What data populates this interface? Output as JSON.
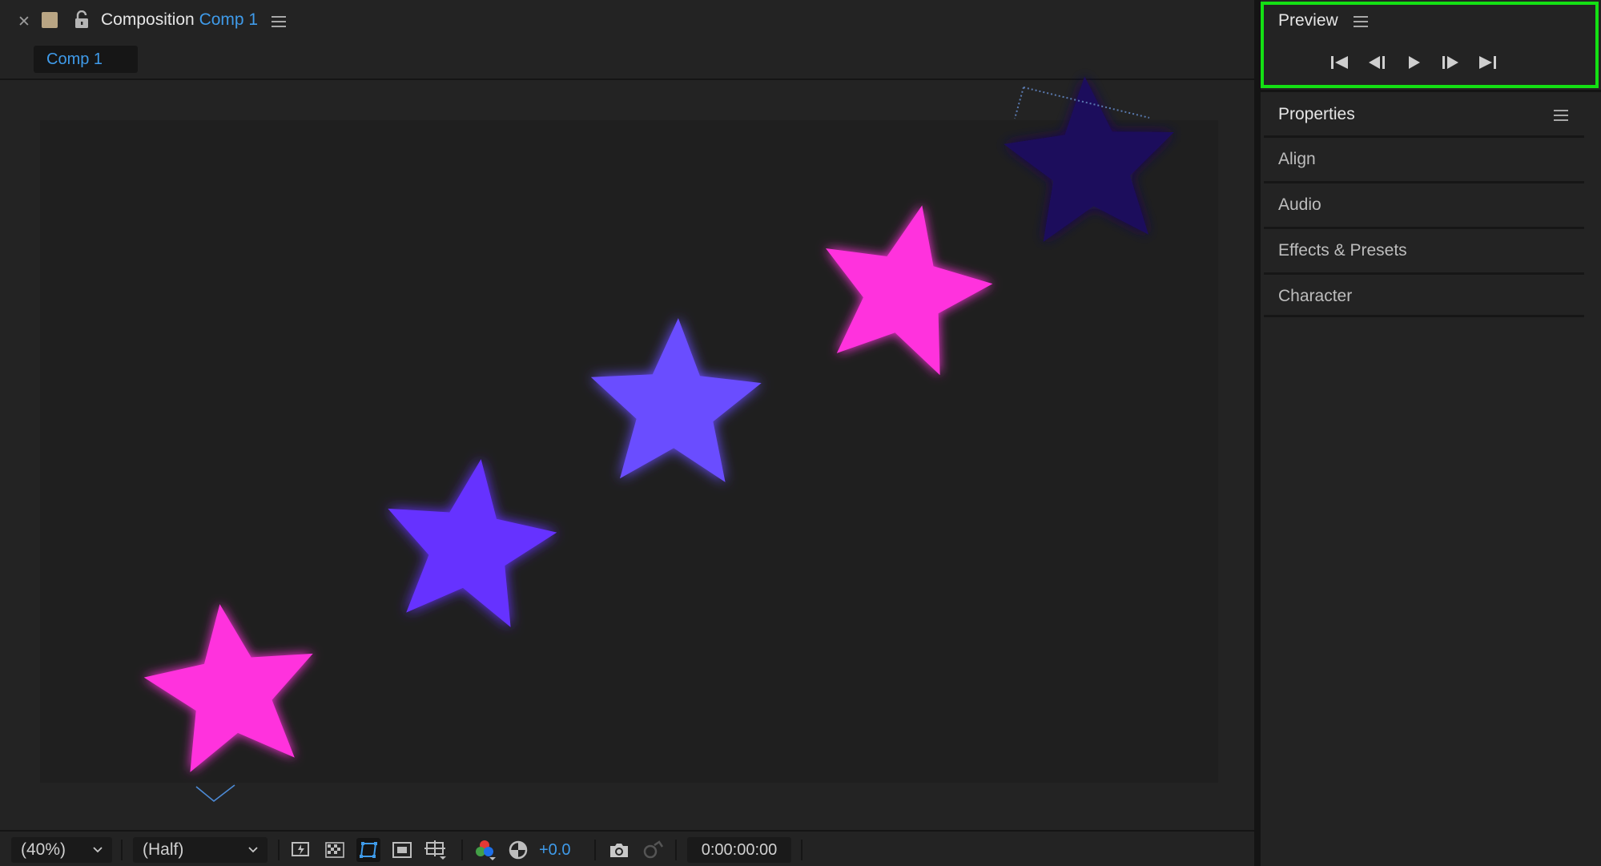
{
  "composition_panel": {
    "title_prefix": "Composition",
    "comp_name": "Comp 1",
    "tab_label": "Comp 1"
  },
  "viewer": {
    "stars": [
      {
        "color": "#ff33dd",
        "glow": "#ff33dd"
      },
      {
        "color": "#6633ff",
        "glow": "#5533ff"
      },
      {
        "color": "#6a4dff",
        "glow": "#4433ff"
      },
      {
        "color": "#ff33dd",
        "glow": "#ff2bd0"
      },
      {
        "color": "#1e0d5c",
        "glow": "#000000"
      }
    ]
  },
  "footer": {
    "magnification": "(40%)",
    "resolution": "(Half)",
    "exposure": "+0.0",
    "timecode": "0:00:00:00"
  },
  "preview_panel": {
    "title": "Preview",
    "controls": [
      "first-frame",
      "previous-frame",
      "play",
      "next-frame",
      "last-frame"
    ]
  },
  "properties_panel": {
    "title": "Properties",
    "items": [
      {
        "label": "Align"
      },
      {
        "label": "Audio"
      },
      {
        "label": "Effects & Presets"
      },
      {
        "label": "Character"
      }
    ]
  },
  "colors": {
    "accent": "#3f9bea",
    "highlight_outline": "#14e014",
    "panel_bg": "#232323"
  }
}
